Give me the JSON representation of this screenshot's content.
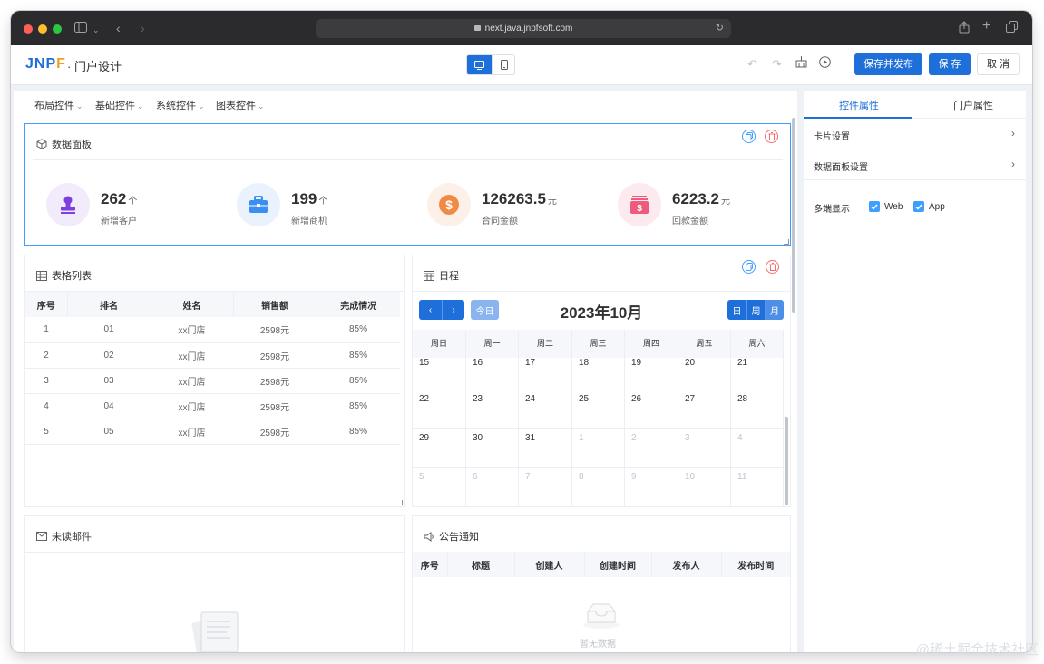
{
  "browser": {
    "url": "next.java.jnpfsoft.com"
  },
  "app": {
    "logo_text_1": "JNP",
    "logo_text_2": "F",
    "title": "· 门户设计",
    "save_publish_label": "保存并发布",
    "save_label": "保 存",
    "cancel_label": "取 消"
  },
  "menubar": {
    "items": [
      {
        "label": "布局控件"
      },
      {
        "label": "基础控件"
      },
      {
        "label": "系统控件"
      },
      {
        "label": "图表控件"
      }
    ]
  },
  "data_panel": {
    "title": "数据面板",
    "stats": [
      {
        "value": "262",
        "unit": "个",
        "label": "新增客户",
        "color": "#7b3fe4",
        "bg": "#f1ebfc"
      },
      {
        "value": "199",
        "unit": "个",
        "label": "新增商机",
        "color": "#3b8ff0",
        "bg": "#eaf3fd"
      },
      {
        "value": "126263.5",
        "unit": "元",
        "label": "合同金额",
        "color": "#f08a45",
        "bg": "#fdf0e8"
      },
      {
        "value": "6223.2",
        "unit": "元",
        "label": "回款金额",
        "color": "#ee5c7d",
        "bg": "#fdeaef"
      }
    ]
  },
  "table_card": {
    "title": "表格列表",
    "columns": [
      "序号",
      "排名",
      "姓名",
      "销售额",
      "完成情况"
    ],
    "rows": [
      [
        "1",
        "01",
        "xx门店",
        "2598元",
        "85%"
      ],
      [
        "2",
        "02",
        "xx门店",
        "2598元",
        "85%"
      ],
      [
        "3",
        "03",
        "xx门店",
        "2598元",
        "85%"
      ],
      [
        "4",
        "04",
        "xx门店",
        "2598元",
        "85%"
      ],
      [
        "5",
        "05",
        "xx门店",
        "2598元",
        "85%"
      ]
    ]
  },
  "calendar": {
    "title": "日程",
    "today_label": "今日",
    "month_title": "2023年10月",
    "view_day": "日",
    "view_week": "周",
    "view_month": "月",
    "weekdays": [
      "周日",
      "周一",
      "周二",
      "周三",
      "周四",
      "周五",
      "周六"
    ],
    "weeks": [
      [
        {
          "d": "15"
        },
        {
          "d": "16"
        },
        {
          "d": "17"
        },
        {
          "d": "18"
        },
        {
          "d": "19"
        },
        {
          "d": "20"
        },
        {
          "d": "21"
        }
      ],
      [
        {
          "d": "22"
        },
        {
          "d": "23"
        },
        {
          "d": "24"
        },
        {
          "d": "25"
        },
        {
          "d": "26"
        },
        {
          "d": "27"
        },
        {
          "d": "28"
        }
      ],
      [
        {
          "d": "29"
        },
        {
          "d": "30"
        },
        {
          "d": "31"
        },
        {
          "d": "1",
          "other": true
        },
        {
          "d": "2",
          "other": true
        },
        {
          "d": "3",
          "other": true
        },
        {
          "d": "4",
          "other": true
        }
      ],
      [
        {
          "d": "5",
          "other": true
        },
        {
          "d": "6",
          "other": true
        },
        {
          "d": "7",
          "other": true
        },
        {
          "d": "8",
          "other": true
        },
        {
          "d": "9",
          "other": true
        },
        {
          "d": "10",
          "other": true
        },
        {
          "d": "11",
          "other": true
        }
      ]
    ]
  },
  "mail_card": {
    "title": "未读邮件"
  },
  "notice_card": {
    "title": "公告通知",
    "columns": [
      "序号",
      "标题",
      "创建人",
      "创建时间",
      "发布人",
      "发布时间"
    ],
    "empty_text": "暂无数据"
  },
  "right_panel": {
    "tab_control": "控件属性",
    "tab_portal": "门户属性",
    "row_card": "卡片设置",
    "row_data": "数据面板设置",
    "multi_label": "多端显示",
    "opt_web": "Web",
    "opt_app": "App"
  },
  "watermark": "@稀土掘金技术社区",
  "colors": {
    "primary": "#1e6fd9",
    "accent": "#409eff",
    "danger": "#f56c6c"
  }
}
